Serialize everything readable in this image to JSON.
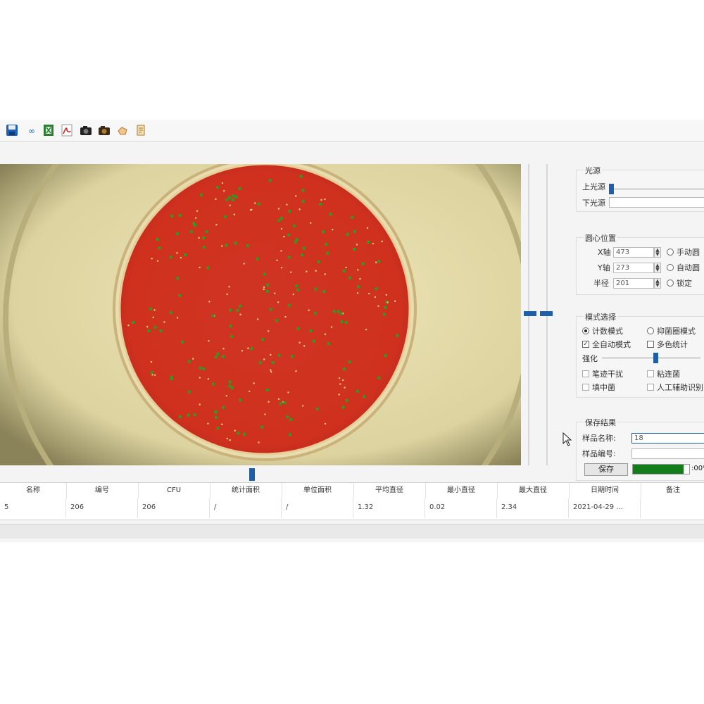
{
  "toolbar": {
    "icons": [
      "save-icon",
      "link-icon",
      "excel-icon",
      "pdf-icon",
      "camera-icon",
      "camera-dark-icon",
      "hand-icon",
      "scroll-icon"
    ]
  },
  "light": {
    "title": "光源",
    "upper_label": "上光源",
    "upper_level": 0.0,
    "lower_label": "下光源"
  },
  "center": {
    "title": "圆心位置",
    "x_label": "X轴",
    "x_value": "473",
    "y_label": "Y轴",
    "y_value": "273",
    "r_label": "半径",
    "r_value": "201",
    "opt_manual": "手动圆",
    "opt_auto": "自动圆",
    "opt_fixed": "锁定"
  },
  "mode": {
    "title": "模式选择",
    "count_mode": "计数模式",
    "inhibit_mode": "抑菌圈模式",
    "auto_mode": "全自动模式",
    "multicolor": "多色统计",
    "enhance_label": "强化",
    "enhance_level": 0.55,
    "remove_interference": "笔迹干扰",
    "sticky": "粘连菌",
    "fill": "填中菌",
    "manual_recog": "人工辅助识别"
  },
  "save": {
    "title": "保存结果",
    "name_label": "样品名称:",
    "name_value": "18",
    "id_label": "样品编号:",
    "id_value": "",
    "save_button": "保存",
    "progress": 0.9,
    "progress_text": ":00%"
  },
  "table": {
    "headers": [
      "名称",
      "编号",
      "CFU",
      "统计面积",
      "单位面积",
      "平均直径",
      "最小直径",
      "最大直径",
      "日期时间",
      "备注"
    ],
    "row": [
      "5",
      "206",
      "206",
      "/",
      "/",
      "1.32",
      "0.02",
      "2.34",
      "2021-04-29 ...",
      ""
    ]
  }
}
